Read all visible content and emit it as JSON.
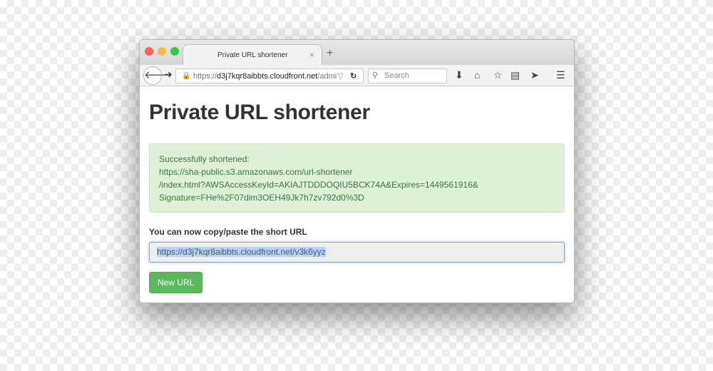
{
  "browser": {
    "tab_title": "Private URL shortener",
    "tab_close": "×",
    "new_tab": "+",
    "url_prefix": "https://",
    "url_host": "d3j7kqr8aibbts.cloudfront.net",
    "url_path": "/admi",
    "search_placeholder": "Search"
  },
  "page": {
    "title": "Private URL shortener",
    "alert_lines": [
      "Successfully shortened:",
      "https://sha-public.s3.amazonaws.com/url-shortener",
      "/index.html?AWSAccessKeyId=AKIAJTDDDOQIU5BCK74A&Expires=1449561916&",
      "Signature=FHe%2F07dim3OEH49Jk7h7zv792d0%3D"
    ],
    "copy_label": "You can now copy/paste the short URL",
    "short_url": "https://d3j7kqr8aibbts.cloudfront.net/v3k6yyz",
    "new_url_button": "New URL"
  },
  "colors": {
    "success_bg": "#dff0d8",
    "success_text": "#3c763d",
    "button": "#5cb85c"
  }
}
